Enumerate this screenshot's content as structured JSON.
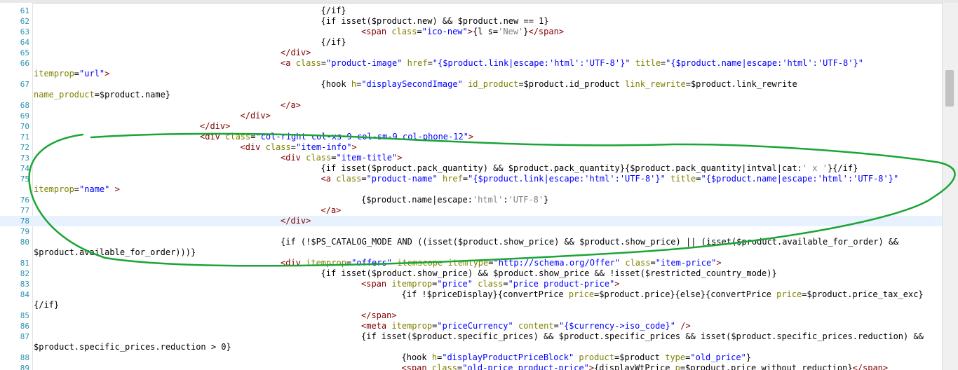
{
  "editor": {
    "current_line": 78,
    "lines": [
      {
        "n": 61,
        "indent": 3,
        "segs": [
          [
            "t-kw",
            "{/if}"
          ]
        ]
      },
      {
        "n": 62,
        "indent": 3,
        "segs": [
          [
            "t-kw",
            "{if isset($product.new) && $product.new == 1}"
          ]
        ]
      },
      {
        "n": 63,
        "indent": 4,
        "segs": [
          [
            "t-tag",
            "<span "
          ],
          [
            "t-attr",
            "class"
          ],
          [
            "t-kw",
            "="
          ],
          [
            "t-str",
            "\"ico-new\""
          ],
          [
            "t-tag",
            ">"
          ],
          [
            "t-kw",
            "{l s="
          ],
          [
            "t-sq",
            "'New'"
          ],
          [
            "t-kw",
            "}"
          ],
          [
            "t-tag",
            "</span>"
          ]
        ]
      },
      {
        "n": 64,
        "indent": 3,
        "segs": [
          [
            "t-kw",
            "{/if}"
          ]
        ]
      },
      {
        "n": 65,
        "indent": 2,
        "segs": [
          [
            "t-tag",
            "</div>"
          ]
        ]
      },
      {
        "n": 66,
        "indent": 2,
        "segs": [
          [
            "t-tag",
            "<a "
          ],
          [
            "t-attr",
            "class"
          ],
          [
            "t-kw",
            "="
          ],
          [
            "t-str",
            "\"product-image\""
          ],
          [
            "t-kw",
            " "
          ],
          [
            "t-attr",
            "href"
          ],
          [
            "t-kw",
            "="
          ],
          [
            "t-str",
            "\"{$product.link|escape:'html':'UTF-8'}\""
          ],
          [
            "t-kw",
            " "
          ],
          [
            "t-attr",
            "title"
          ],
          [
            "t-kw",
            "="
          ],
          [
            "t-str",
            "\"{$product.name|escape:'html':'UTF-8'}\""
          ]
        ]
      },
      {
        "n": null,
        "indent": 0,
        "segs": [
          [
            "t-attr",
            "itemprop"
          ],
          [
            "t-kw",
            "="
          ],
          [
            "t-str",
            "\"url\""
          ],
          [
            "t-tag",
            ">"
          ]
        ]
      },
      {
        "n": 67,
        "indent": 3,
        "segs": [
          [
            "t-kw",
            "{hook "
          ],
          [
            "t-attr",
            "h"
          ],
          [
            "t-kw",
            "="
          ],
          [
            "t-str",
            "\"displaySecondImage\""
          ],
          [
            "t-kw",
            " "
          ],
          [
            "t-attr",
            "id_product"
          ],
          [
            "t-kw",
            "=$product.id_product "
          ],
          [
            "t-attr",
            "link_rewrite"
          ],
          [
            "t-kw",
            "=$product.link_rewrite"
          ]
        ]
      },
      {
        "n": null,
        "indent": 0,
        "segs": [
          [
            "t-attr",
            "name_product"
          ],
          [
            "t-kw",
            "=$product.name}"
          ]
        ]
      },
      {
        "n": 68,
        "indent": 2,
        "segs": [
          [
            "t-tag",
            "</a>"
          ]
        ]
      },
      {
        "n": 69,
        "indent": 1,
        "segs": [
          [
            "t-tag",
            "</div>"
          ]
        ]
      },
      {
        "n": 70,
        "indent": 0,
        "segs": [
          [
            "t-tag",
            "</div>"
          ]
        ]
      },
      {
        "n": 71,
        "indent": 0,
        "segs": [
          [
            "t-tag",
            "<div "
          ],
          [
            "t-attr",
            "class"
          ],
          [
            "t-kw",
            "="
          ],
          [
            "t-str",
            "\"col-right col-xs-9 col-sm-9 col-phone-12\""
          ],
          [
            "t-tag",
            ">"
          ]
        ]
      },
      {
        "n": 72,
        "indent": 1,
        "segs": [
          [
            "t-tag",
            "<div "
          ],
          [
            "t-attr",
            "class"
          ],
          [
            "t-kw",
            "="
          ],
          [
            "t-str",
            "\"item-info\""
          ],
          [
            "t-tag",
            ">"
          ]
        ]
      },
      {
        "n": 73,
        "indent": 2,
        "segs": [
          [
            "t-tag",
            "<div "
          ],
          [
            "t-attr",
            "class"
          ],
          [
            "t-kw",
            "="
          ],
          [
            "t-str",
            "\"item-title\""
          ],
          [
            "t-tag",
            ">"
          ]
        ]
      },
      {
        "n": 74,
        "indent": 3,
        "segs": [
          [
            "t-kw",
            "{if isset($product.pack_quantity) && $product.pack_quantity}{$product.pack_quantity|intval|cat:"
          ],
          [
            "t-sq",
            "' x '"
          ],
          [
            "t-kw",
            "}{/if}"
          ]
        ]
      },
      {
        "n": 75,
        "indent": 3,
        "segs": [
          [
            "t-tag",
            "<a "
          ],
          [
            "t-attr",
            "class"
          ],
          [
            "t-kw",
            "="
          ],
          [
            "t-str",
            "\"product-name\""
          ],
          [
            "t-kw",
            " "
          ],
          [
            "t-attr",
            "href"
          ],
          [
            "t-kw",
            "="
          ],
          [
            "t-str",
            "\"{$product.link|escape:'html':'UTF-8'}\""
          ],
          [
            "t-kw",
            " "
          ],
          [
            "t-attr",
            "title"
          ],
          [
            "t-kw",
            "="
          ],
          [
            "t-str",
            "\"{$product.name|escape:'html':'UTF-8'}\""
          ]
        ]
      },
      {
        "n": null,
        "indent": 0,
        "segs": [
          [
            "t-attr",
            "itemprop"
          ],
          [
            "t-kw",
            "="
          ],
          [
            "t-str",
            "\"name\""
          ],
          [
            "t-kw",
            " "
          ],
          [
            "t-tag",
            ">"
          ]
        ]
      },
      {
        "n": 76,
        "indent": 4,
        "segs": [
          [
            "t-kw",
            "{$product.name|escape:"
          ],
          [
            "t-sq",
            "'html'"
          ],
          [
            "t-kw",
            ":"
          ],
          [
            "t-sq",
            "'UTF-8'"
          ],
          [
            "t-kw",
            "}"
          ]
        ]
      },
      {
        "n": 77,
        "indent": 3,
        "segs": [
          [
            "t-tag",
            "</a>"
          ]
        ]
      },
      {
        "n": 78,
        "indent": 2,
        "segs": [
          [
            "t-tag",
            "</div>"
          ]
        ]
      },
      {
        "n": 79,
        "indent": 0,
        "segs": []
      },
      {
        "n": 80,
        "indent": 2,
        "segs": [
          [
            "t-kw",
            "{if (!$PS_CATALOG_MODE AND ((isset($product.show_price) && $product.show_price) || (isset($product.available_for_order) &&"
          ]
        ]
      },
      {
        "n": null,
        "indent": 0,
        "segs": [
          [
            "t-kw",
            "$product.available_for_order)))}"
          ]
        ]
      },
      {
        "n": 81,
        "indent": 2,
        "segs": [
          [
            "t-tag",
            "<div "
          ],
          [
            "t-attr",
            "itemprop"
          ],
          [
            "t-kw",
            "="
          ],
          [
            "t-str",
            "\"offers\""
          ],
          [
            "t-kw",
            " "
          ],
          [
            "t-attr",
            "itemscope"
          ],
          [
            "t-kw",
            " "
          ],
          [
            "t-attr",
            "itemtype"
          ],
          [
            "t-kw",
            "="
          ],
          [
            "t-str",
            "\"http://schema.org/Offer\""
          ],
          [
            "t-kw",
            " "
          ],
          [
            "t-attr",
            "class"
          ],
          [
            "t-kw",
            "="
          ],
          [
            "t-str",
            "\"item-price\""
          ],
          [
            "t-tag",
            ">"
          ]
        ]
      },
      {
        "n": 82,
        "indent": 3,
        "segs": [
          [
            "t-kw",
            "{if isset($product.show_price) && $product.show_price && !isset($restricted_country_mode)}"
          ]
        ]
      },
      {
        "n": 83,
        "indent": 4,
        "segs": [
          [
            "t-tag",
            "<span "
          ],
          [
            "t-attr",
            "itemprop"
          ],
          [
            "t-kw",
            "="
          ],
          [
            "t-str",
            "\"price\""
          ],
          [
            "t-kw",
            " "
          ],
          [
            "t-attr",
            "class"
          ],
          [
            "t-kw",
            "="
          ],
          [
            "t-str",
            "\"price product-price\""
          ],
          [
            "t-tag",
            ">"
          ]
        ]
      },
      {
        "n": 84,
        "indent": 5,
        "segs": [
          [
            "t-kw",
            "{if !$priceDisplay}{convertPrice "
          ],
          [
            "t-attr",
            "price"
          ],
          [
            "t-kw",
            "=$product.price}{else}{convertPrice "
          ],
          [
            "t-attr",
            "price"
          ],
          [
            "t-kw",
            "=$product.price_tax_exc}"
          ]
        ]
      },
      {
        "n": null,
        "indent": 0,
        "segs": [
          [
            "t-kw",
            "{/if}"
          ]
        ]
      },
      {
        "n": 85,
        "indent": 4,
        "segs": [
          [
            "t-tag",
            "</span>"
          ]
        ]
      },
      {
        "n": 86,
        "indent": 4,
        "segs": [
          [
            "t-tag",
            "<meta "
          ],
          [
            "t-attr",
            "itemprop"
          ],
          [
            "t-kw",
            "="
          ],
          [
            "t-str",
            "\"priceCurrency\""
          ],
          [
            "t-kw",
            " "
          ],
          [
            "t-attr",
            "content"
          ],
          [
            "t-kw",
            "="
          ],
          [
            "t-str",
            "\"{$currency->iso_code}\""
          ],
          [
            "t-kw",
            " "
          ],
          [
            "t-tag",
            "/>"
          ]
        ]
      },
      {
        "n": 87,
        "indent": 4,
        "segs": [
          [
            "t-kw",
            "{if isset($product.specific_prices) && $product.specific_prices && isset($product.specific_prices.reduction) &&"
          ]
        ]
      },
      {
        "n": null,
        "indent": 0,
        "segs": [
          [
            "t-kw",
            "$product.specific_prices.reduction > 0}"
          ]
        ]
      },
      {
        "n": 88,
        "indent": 5,
        "segs": [
          [
            "t-kw",
            "{hook "
          ],
          [
            "t-attr",
            "h"
          ],
          [
            "t-kw",
            "="
          ],
          [
            "t-str",
            "\"displayProductPriceBlock\""
          ],
          [
            "t-kw",
            " "
          ],
          [
            "t-attr",
            "product"
          ],
          [
            "t-kw",
            "=$product "
          ],
          [
            "t-attr",
            "type"
          ],
          [
            "t-kw",
            "="
          ],
          [
            "t-str",
            "\"old_price\""
          ],
          [
            "t-kw",
            "}"
          ]
        ]
      },
      {
        "n": 89,
        "indent": 5,
        "segs": [
          [
            "t-tag",
            "<span "
          ],
          [
            "t-attr",
            "class"
          ],
          [
            "t-kw",
            "="
          ],
          [
            "t-str",
            "\"old-price product-price\""
          ],
          [
            "t-tag",
            ">"
          ],
          [
            "t-kw",
            "{displayWtPrice "
          ],
          [
            "t-attr",
            "p"
          ],
          [
            "t-kw",
            "=$product.price_without_reduction}"
          ],
          [
            "t-tag",
            "</span>"
          ]
        ]
      }
    ]
  }
}
